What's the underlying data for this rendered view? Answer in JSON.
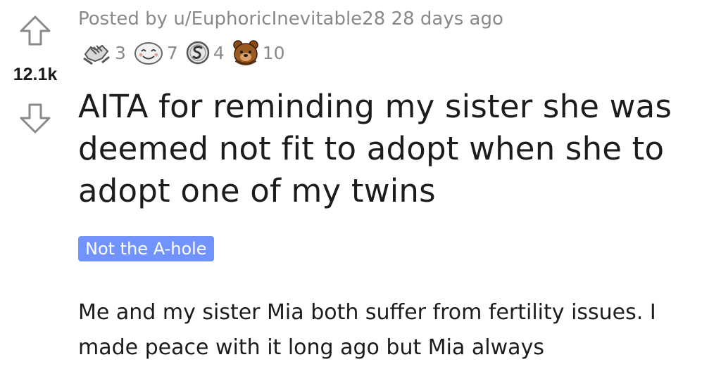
{
  "post": {
    "posted_by_prefix": "Posted by",
    "author": "u/EuphoricInevitable28",
    "time_ago": "28 days ago",
    "score": "12.1k",
    "awards": [
      {
        "icon": "handshake-award-icon",
        "count": "3"
      },
      {
        "icon": "wholesome-face-award-icon",
        "count": "7"
      },
      {
        "icon": "silver-coin-award-icon",
        "count": "4"
      },
      {
        "icon": "bear-award-icon",
        "count": "10"
      }
    ],
    "title": "AITA for reminding my sister she was deemed not fit to adopt when she to adopt one of my twins",
    "flair": "Not the A-hole",
    "body": "Me and my sister Mia both suffer from fertility issues. I made peace with it long ago but Mia always"
  },
  "colors": {
    "flair_bg": "#7193ff",
    "meta_text": "#878a8c",
    "title_text": "#1c1c1c"
  }
}
